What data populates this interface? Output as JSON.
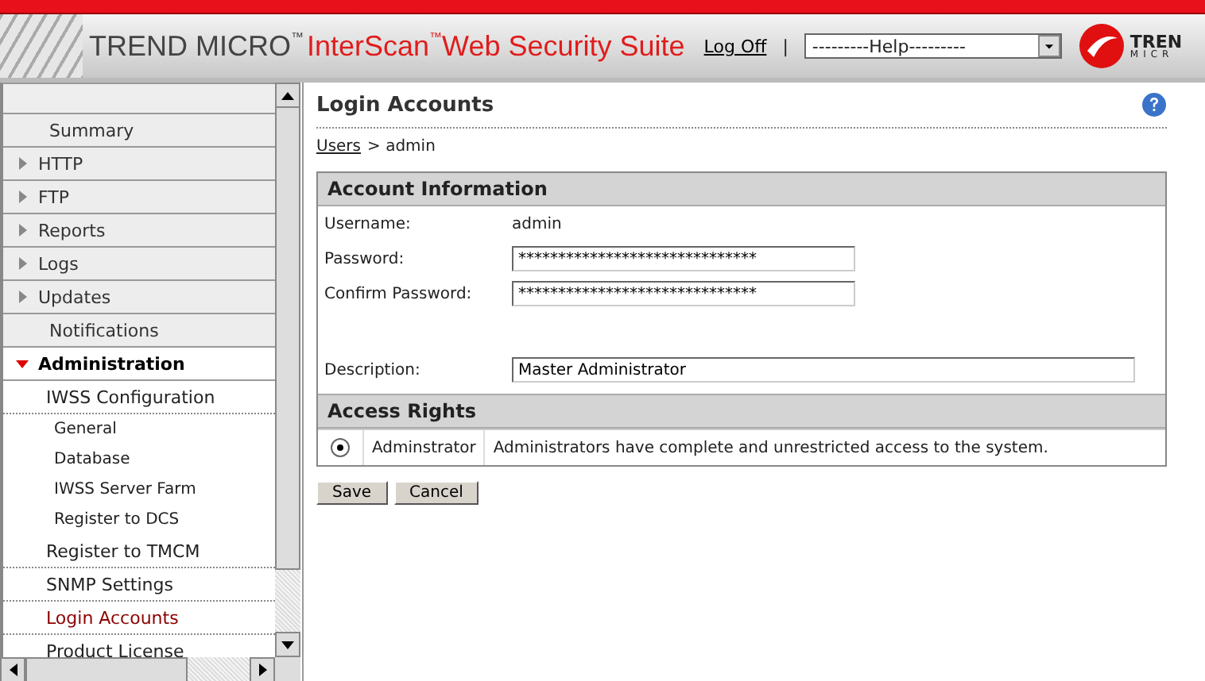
{
  "header": {
    "brand": "TREND MICRO",
    "brand_mark": "™",
    "product": "InterScan",
    "product_mark": "™",
    "product_rest": "Web Security Suite",
    "logoff": "Log Off",
    "separator": "|",
    "help_select": "---------Help---------",
    "logo_line1": "TREN",
    "logo_line2": "MICR"
  },
  "sidebar": {
    "items": [
      {
        "kind": "section",
        "label": "Summary",
        "selected": false
      },
      {
        "kind": "section",
        "label": "HTTP",
        "expanded": false,
        "selected": false
      },
      {
        "kind": "section",
        "label": "FTP",
        "expanded": false,
        "selected": false
      },
      {
        "kind": "section",
        "label": "Reports",
        "expanded": false,
        "selected": false
      },
      {
        "kind": "section",
        "label": "Logs",
        "expanded": false,
        "selected": false
      },
      {
        "kind": "section",
        "label": "Updates",
        "expanded": false,
        "selected": false
      },
      {
        "kind": "section",
        "label": "Notifications",
        "selected": false
      },
      {
        "kind": "section",
        "label": "Administration",
        "expanded": true,
        "selected": false
      },
      {
        "kind": "group",
        "label": "IWSS Configuration",
        "selected": false
      },
      {
        "kind": "subitem",
        "label": "General",
        "selected": false
      },
      {
        "kind": "subitem",
        "label": "Database",
        "selected": false
      },
      {
        "kind": "subitem",
        "label": "IWSS Server Farm",
        "selected": false
      },
      {
        "kind": "subitem",
        "label": "Register to DCS",
        "selected": false
      },
      {
        "kind": "link",
        "label": "Register to TMCM",
        "selected": false
      },
      {
        "kind": "link",
        "label": "SNMP Settings",
        "selected": false
      },
      {
        "kind": "link",
        "label": "Login Accounts",
        "selected": true
      },
      {
        "kind": "link",
        "label": "Product License",
        "selected": false
      }
    ]
  },
  "page": {
    "title": "Login Accounts",
    "breadcrumb_link": "Users",
    "breadcrumb_rest": "> admin",
    "account": {
      "heading": "Account Information",
      "username_label": "Username:",
      "username": "admin",
      "password_label": "Password:",
      "password": "******************************",
      "confirm_label": "Confirm Password:",
      "confirm": "******************************",
      "description_label": "Description:",
      "description": "Master Administrator"
    },
    "access": {
      "heading": "Access Rights",
      "options": [
        {
          "label": "Adminstrator",
          "description": "Administrators have complete and unrestricted access to the system.",
          "selected": true
        }
      ]
    },
    "buttons": [
      "Save",
      "Cancel"
    ]
  }
}
